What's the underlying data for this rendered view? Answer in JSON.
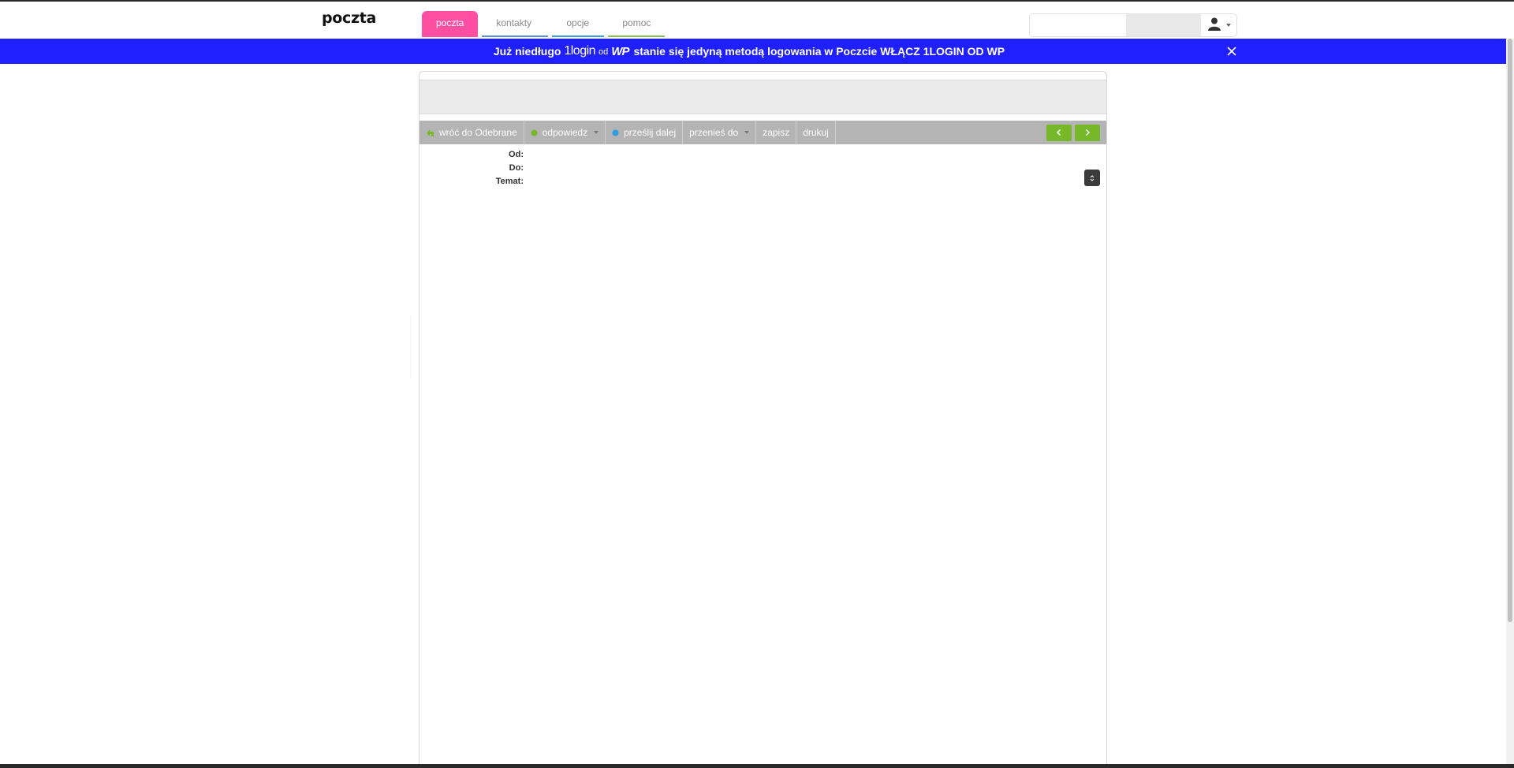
{
  "header": {
    "logo": "poczta",
    "tabs": [
      {
        "label": "poczta"
      },
      {
        "label": "kontakty"
      },
      {
        "label": "opcje"
      },
      {
        "label": "pomoc"
      }
    ]
  },
  "banner": {
    "text_before": "Już niedługo ",
    "brand_login": "1login",
    "brand_od": "od",
    "brand_wp": "WP",
    "text_after": "stanie się jedyną metodą logowania w Poczcie WŁĄCZ 1LOGIN OD WP"
  },
  "toolbar": {
    "back_label": "wróć do Odebrane",
    "reply_label": "odpowiedz",
    "forward_label": "prześlij dalej",
    "move_label": "przenieś do",
    "save_label": "zapisz",
    "print_label": "drukuj"
  },
  "message": {
    "from_label": "Od:",
    "from_value": "",
    "to_label": "Do:",
    "to_value": "",
    "subject_label": "Temat:",
    "subject_value": ""
  },
  "colors": {
    "active_tab": "#ff4fa3",
    "banner": "#2020ff",
    "toolbar": "#b4b4b4",
    "nav_arrows": "#76b82a"
  },
  "icons": [
    "user-icon",
    "chevron-down-icon",
    "close-icon",
    "back-arrow-icon",
    "reply-icon",
    "forward-icon",
    "dropdown-arrow-icon",
    "arrow-left-icon",
    "arrow-right-icon",
    "expand-headers-icon"
  ]
}
